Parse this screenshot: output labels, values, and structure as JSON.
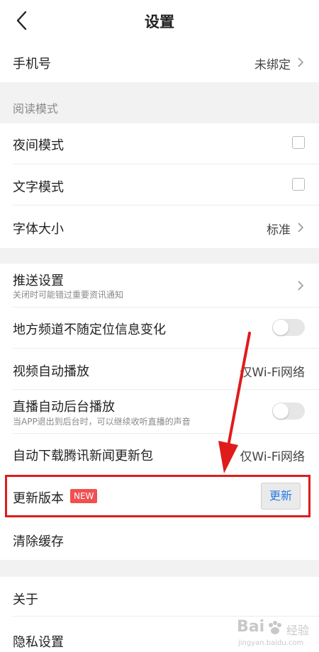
{
  "header": {
    "title": "设置"
  },
  "rows": {
    "phone": {
      "label": "手机号",
      "value": "未绑定"
    },
    "reading_section": "阅读模式",
    "night_mode": {
      "label": "夜间模式"
    },
    "text_mode": {
      "label": "文字模式"
    },
    "font_size": {
      "label": "字体大小",
      "value": "标准"
    },
    "push": {
      "label": "推送设置",
      "sub": "关闭时可能错过重要资讯通知"
    },
    "local_channel": {
      "label": "地方频道不随定位信息变化"
    },
    "video_autoplay": {
      "label": "视频自动播放",
      "value": "仅Wi-Fi网络"
    },
    "live_background": {
      "label": "直播自动后台播放",
      "sub": "当APP退出到后台时，可以继续收听直播的声音"
    },
    "auto_download": {
      "label": "自动下载腾讯新闻更新包",
      "value": "仅Wi-Fi网络"
    },
    "update_version": {
      "label": "更新版本",
      "badge": "NEW",
      "button": "更新"
    },
    "clear_cache": {
      "label": "清除缓存"
    },
    "about": {
      "label": "关于"
    },
    "privacy": {
      "label": "隐私设置"
    }
  },
  "watermark": {
    "brand": "Bai",
    "sub": "jingyan.baidu.com",
    "cn": "经验"
  },
  "colors": {
    "highlight": "#e01b1b",
    "badge": "#f05050",
    "link_blue": "#2a7ae4",
    "section_bg": "#f2f2f2"
  }
}
